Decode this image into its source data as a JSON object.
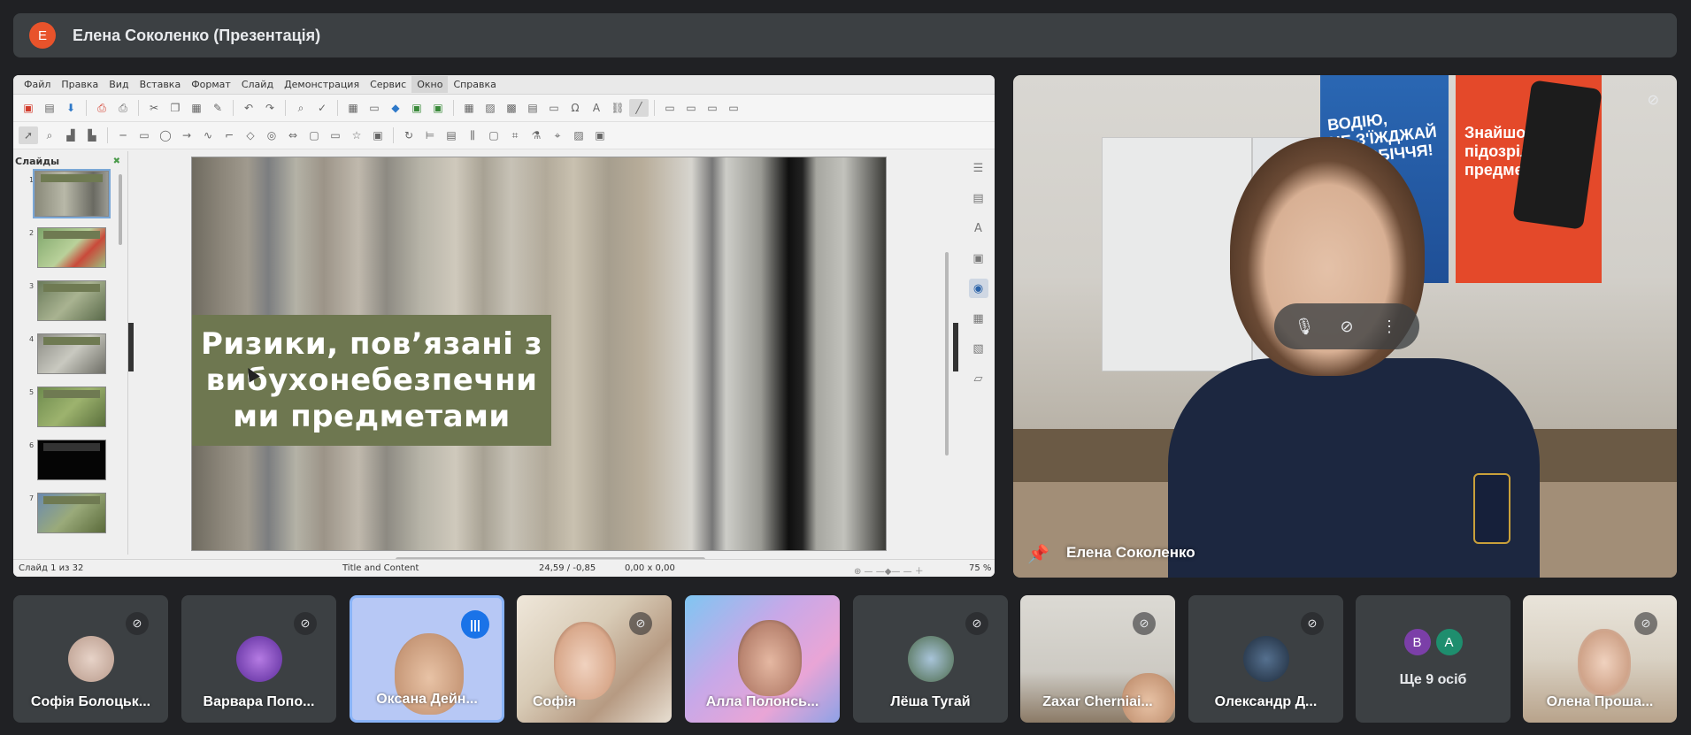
{
  "presenter_bar": {
    "avatar_letter": "E",
    "avatar_color": "#e8532b",
    "title": "Елена Соколенко (Презентація)"
  },
  "impress": {
    "menu": [
      "Файл",
      "Правка",
      "Вид",
      "Вставка",
      "Формат",
      "Слайд",
      "Демонстрация",
      "Сервис",
      "Окно",
      "Справка"
    ],
    "active_menu_index": 8,
    "slides_panel_title": "Слайды",
    "thumbnails": [
      "1",
      "2",
      "3",
      "4",
      "5",
      "6",
      "7"
    ],
    "selected_slide": "1",
    "slide_title": "Ризики, пов’язані з\nвибухонебезпечни\nми предметами",
    "status": {
      "slide_of": "Слайд 1 из 32",
      "layout": "Title and Content",
      "position": "24,59 / -0,85",
      "size": "0,00 x 0,00",
      "zoom": "75 %"
    }
  },
  "presenter_cam": {
    "name": "Елена Соколенко",
    "poster1_text": "ВОДІЮ,\nНЕ З'ЇЖДЖАЙ\nНА УЗБІЧЧЯ!",
    "poster2_text": "Знайшов\nпідозрілий\nпредмет?",
    "icons": [
      "mic-off-icon",
      "pin-icon",
      "more-vert-icon"
    ]
  },
  "participants": [
    {
      "name": "Софія Болоцьк...",
      "muted": true,
      "avatar_color": "#c9b3a8",
      "video": false
    },
    {
      "name": "Варвара Попо...",
      "muted": true,
      "avatar_color": "#8a3fd1",
      "video": false
    },
    {
      "name": "Оксана Дейн...",
      "muted": false,
      "speaking": true,
      "video": true
    },
    {
      "name": "Софія",
      "muted": true,
      "video": true
    },
    {
      "name": "Алла Полонсь...",
      "muted": false,
      "video": true
    },
    {
      "name": "Лёша Тугай",
      "muted": true,
      "avatar_color": "#6d8fb0",
      "video": false
    },
    {
      "name": "Zaxar Cherniai...",
      "muted": true,
      "video": true
    },
    {
      "name": "Олександр Д...",
      "muted": true,
      "avatar_color": "#2d3e55",
      "video": false
    },
    {
      "name": "Олена Проша...",
      "muted": true,
      "video": true
    }
  ],
  "more_people": {
    "label": "Ще 9 осіб",
    "avatars": [
      {
        "letter": "В",
        "color": "#7b3fa8"
      },
      {
        "letter": "А",
        "color": "#1e8e6e"
      }
    ]
  }
}
